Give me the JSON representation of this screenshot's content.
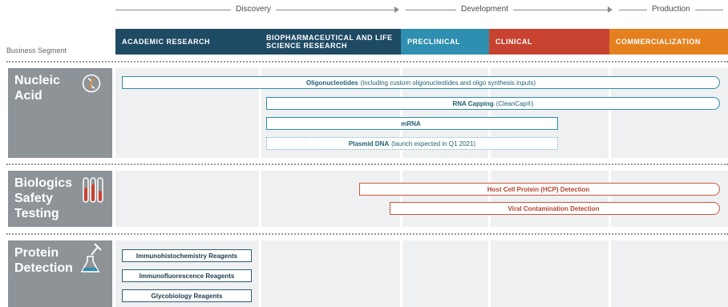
{
  "phases": {
    "discovery": "Discovery",
    "development": "Development",
    "production": "Production"
  },
  "business_segment_label": "Business Segment",
  "stages": [
    {
      "label": "ACADEMIC RESEARCH",
      "color": "#1e4a64"
    },
    {
      "label": "BIOPHARMACEUTICAL AND LIFE SCIENCE RESEARCH",
      "color": "#1e4a64"
    },
    {
      "label": "PRECLINICAL",
      "color": "#2f8fb0"
    },
    {
      "label": "CLINICAL",
      "color": "#c8432f"
    },
    {
      "label": "COMMERCIALIZATION",
      "color": "#e5801f"
    }
  ],
  "segments": {
    "nucleic_acid": {
      "label": "Nucleic Acid",
      "icon": "dna-icon"
    },
    "biologics": {
      "label": "Biologics Safety Testing",
      "icon": "test-tubes-icon"
    },
    "protein": {
      "label": "Protein Detection",
      "icon": "flask-dropper-icon"
    }
  },
  "products": {
    "oligo": {
      "name": "Oligonucleotides",
      "detail": "(including custom oligonucleotides and oligo synthesis inputs)"
    },
    "rna_capping": {
      "name": "RNA Capping",
      "detail": "(CleanCap®)"
    },
    "mrna": {
      "name": "mRNA",
      "detail": ""
    },
    "plasmid": {
      "name": "Plasmid DNA",
      "detail": "(launch expected in Q1 2021)"
    },
    "hcp": {
      "name": "Host Cell Protein (HCP) Detection",
      "detail": ""
    },
    "viral": {
      "name": "Viral Contamination Detection",
      "detail": ""
    },
    "ihc": {
      "name": "Immunohistochemistry Reagents"
    },
    "if": {
      "name": "Immunofluorescence Reagents"
    },
    "glyco": {
      "name": "Glycobiology Reagents"
    }
  },
  "colors": {
    "teal": "#2f8ea6",
    "red": "#d0553b",
    "segment_gray": "#8e9397",
    "band": "#eef0f2"
  }
}
